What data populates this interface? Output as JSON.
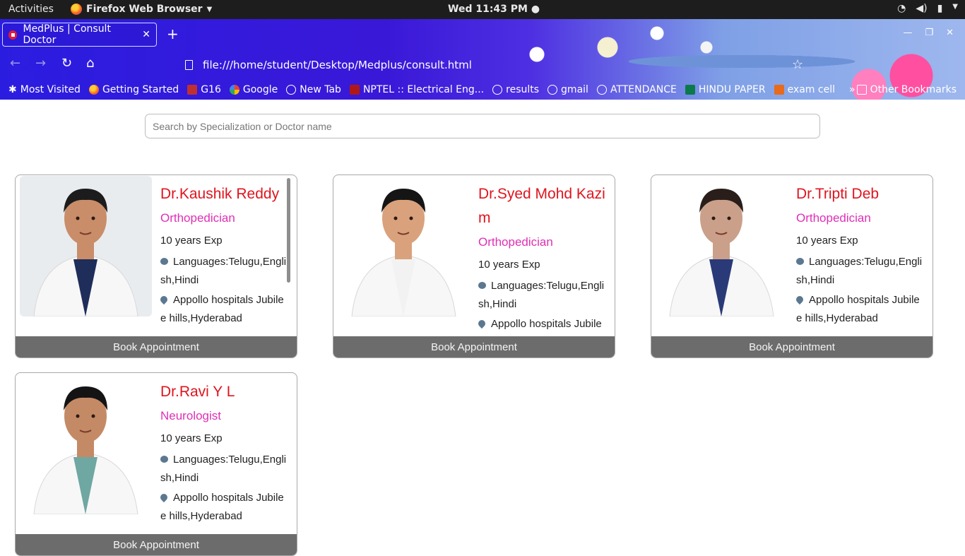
{
  "system_bar": {
    "activities": "Activities",
    "app_name": "Firefox Web Browser",
    "clock": "Wed 11:43 PM"
  },
  "browser": {
    "tab_title": "MedPlus | Consult Doctor",
    "url": "file:///home/student/Desktop/Medplus/consult.html",
    "bookmarks": [
      {
        "label": "Most Visited",
        "icon": "star-icon"
      },
      {
        "label": "Getting Started",
        "icon": "firefox-icon"
      },
      {
        "label": "G16",
        "icon": "g16-icon"
      },
      {
        "label": "Google",
        "icon": "google-icon"
      },
      {
        "label": "New Tab",
        "icon": "globe-icon"
      },
      {
        "label": "NPTEL :: Electrical Eng...",
        "icon": "nptel-icon"
      },
      {
        "label": "results",
        "icon": "globe-icon"
      },
      {
        "label": "gmail",
        "icon": "globe-icon"
      },
      {
        "label": "ATTENDANCE",
        "icon": "globe-icon"
      },
      {
        "label": "HINDU PAPER",
        "icon": "hindu-icon"
      },
      {
        "label": "exam cell",
        "icon": "exam-icon"
      }
    ],
    "other_bookmarks": "Other Bookmarks"
  },
  "search": {
    "placeholder": "Search by Specialization or Doctor name"
  },
  "doctors": [
    {
      "name": "Dr.Kaushik Reddy",
      "specialization": "Orthopedician",
      "experience": "10 years Exp",
      "languages": "Languages:Telugu,English,Hindi",
      "address": "Appollo hospitals Jubilee hills,Hyderabad",
      "book_label": "Book Appointment"
    },
    {
      "name": "Dr.Syed Mohd Kazim",
      "specialization": "Orthopedician",
      "experience": "10 years Exp",
      "languages": "Languages:Telugu,English,Hindi",
      "address": "Appollo hospitals Jubilee",
      "book_label": "Book Appointment"
    },
    {
      "name": "Dr.Tripti Deb",
      "specialization": "Orthopedician",
      "experience": "10 years Exp",
      "languages": "Languages:Telugu,English,Hindi",
      "address": "Appollo hospitals Jubilee hills,Hyderabad",
      "book_label": "Book Appointment"
    },
    {
      "name": "Dr.Ravi Y L",
      "specialization": "Neurologist",
      "experience": "10 years Exp",
      "languages": "Languages:Telugu,English,Hindi",
      "address": "Appollo hospitals Jubilee hills,Hyderabad",
      "book_label": "Book Appointment"
    }
  ],
  "colors": {
    "doctor_name": "#e0141e",
    "specialization": "#df2fb6",
    "book_button": "#6c6c6c",
    "icon": "#5b7890"
  }
}
